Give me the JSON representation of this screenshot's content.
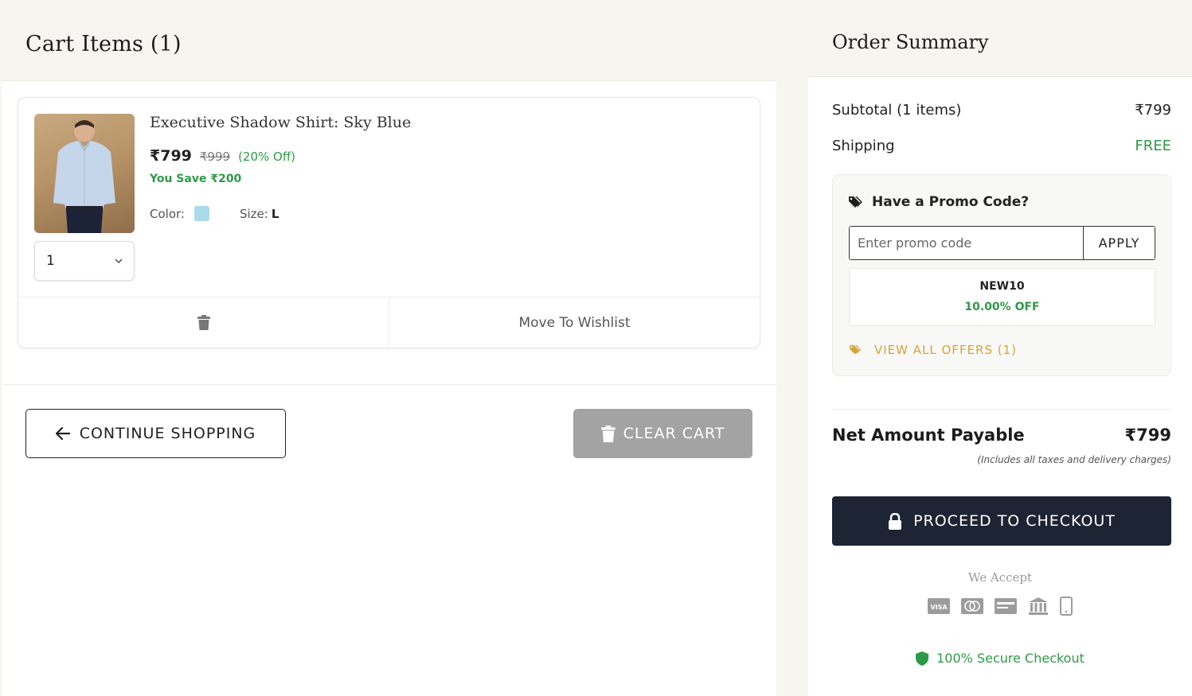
{
  "cart": {
    "title": "Cart Items (1)",
    "item": {
      "name": "Executive Shadow Shirt: Sky Blue",
      "price": "₹799",
      "original_price": "₹999",
      "discount": "(20% Off)",
      "savings": "You Save ₹200",
      "color_label": "Color:",
      "color_hex": "#a9dbe8",
      "size_label": "Size:",
      "size_value": "L",
      "quantity": "1",
      "wishlist_label": "Move To Wishlist"
    },
    "continue_label": "CONTINUE SHOPPING",
    "clear_label": "CLEAR CART"
  },
  "summary": {
    "title": "Order Summary",
    "subtotal_label": "Subtotal (1 items)",
    "subtotal_value": "₹799",
    "shipping_label": "Shipping",
    "shipping_value": "FREE",
    "promo": {
      "title": "Have a Promo Code?",
      "placeholder": "Enter promo code",
      "apply_label": "APPLY",
      "offer_code": "NEW10",
      "offer_discount": "10.00% OFF",
      "view_all": "VIEW ALL OFFERS (1)"
    },
    "net_label": "Net Amount Payable",
    "net_value": "₹799",
    "net_note": "(Includes all taxes and delivery charges)",
    "checkout_label": "PROCEED TO CHECKOUT",
    "we_accept": "We Accept",
    "secure_label": "100% Secure Checkout"
  },
  "colors": {
    "accent_green": "#2e9a47",
    "checkout_bg": "#1d2433",
    "offer_gold": "#d4a437",
    "clear_bg": "#a3a3a3"
  },
  "icons": {
    "payment": [
      "visa-icon",
      "mastercard-icon",
      "card-icon",
      "bank-icon",
      "mobile-icon"
    ]
  }
}
